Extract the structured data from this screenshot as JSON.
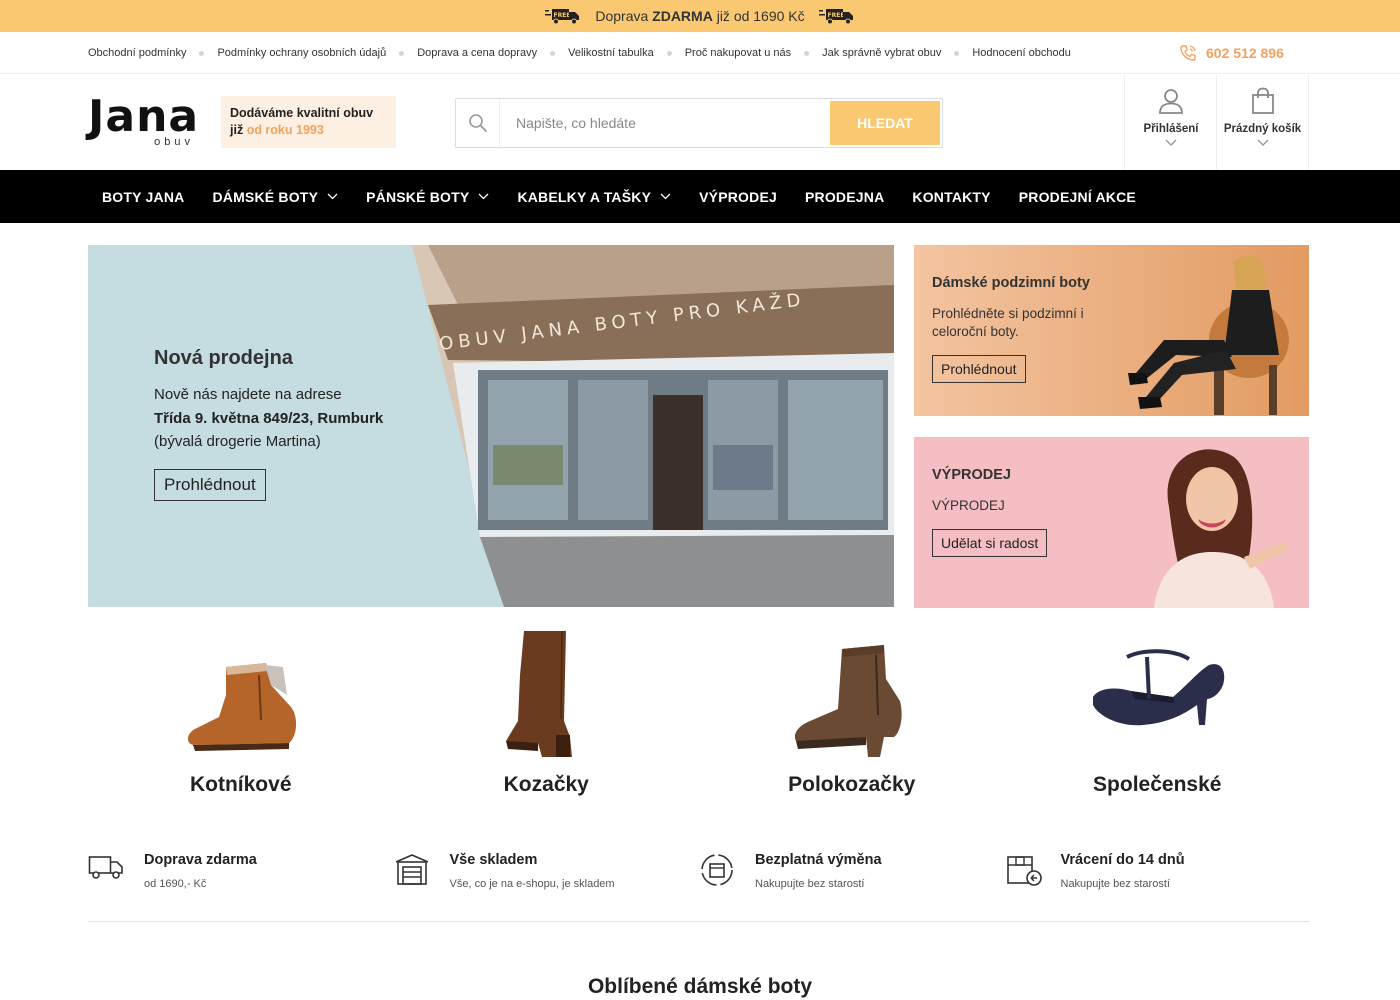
{
  "topbar": {
    "prefix": "Doprava",
    "bold": "ZDARMA",
    "suffix": "již od 1690 Kč",
    "badge": "FREE"
  },
  "links": {
    "items": [
      "Obchodní podmínky",
      "Podmínky ochrany osobních údajů",
      "Doprava a cena dopravy",
      "Velikostní tabulka",
      "Proč nakupovat u nás",
      "Jak správně vybrat obuv",
      "Hodnocení obchodu"
    ],
    "phone": "602 512 896"
  },
  "logo": {
    "word": "Jana",
    "sub": "obuv"
  },
  "tagline": {
    "line1": "Dodáváme kvalitní obuv",
    "prefix": "již",
    "highlight": "od roku 1993"
  },
  "search": {
    "placeholder": "Napište, co hledáte",
    "button": "HLEDAT"
  },
  "account": {
    "login": "Přihlášení",
    "cart": "Prázdný košík"
  },
  "nav": [
    "BOTY JANA",
    "DÁMSKÉ BOTY",
    "PÁNSKÉ BOTY",
    "KABELKY A TAŠKY",
    "VÝPRODEJ",
    "PRODEJNA",
    "KONTAKTY",
    "PRODEJNÍ AKCE"
  ],
  "hero": {
    "title": "Nová prodejna",
    "line1": "Nově nás najdete na adrese",
    "address": "Třída 9. května 849/23, Rumburk",
    "note": "(bývalá drogerie Martina)",
    "button": "Prohlédnout",
    "sign": "OBUV JANA   BOTY PRO KAŽD"
  },
  "promos": [
    {
      "title": "Dámské podzimní boty",
      "text": "Prohlédněte si podzimní i celoroční boty.",
      "button": "Prohlédnout"
    },
    {
      "title": "VÝPRODEJ",
      "text": "VÝPRODEJ",
      "button": "Udělat si radost"
    }
  ],
  "categories": [
    "Kotníkové",
    "Kozačky",
    "Polokozačky",
    "Společenské"
  ],
  "benefits": [
    {
      "title": "Doprava zdarma",
      "sub": "od 1690,- Kč"
    },
    {
      "title": "Vše skladem",
      "sub": "Vše, co je na e-shopu, je skladem"
    },
    {
      "title": "Bezplatná výměna",
      "sub": "Nakupujte bez starostí"
    },
    {
      "title": "Vrácení do 14 dnů",
      "sub": "Nakupujte bez starostí"
    }
  ],
  "section_title": "Oblíbené dámské boty",
  "colors": {
    "accent": "#fbc872",
    "accent_text": "#f3a25e",
    "nav_bg": "#000000",
    "hero_bg": "#c5dde1",
    "promo1_bg": "#e8a36d",
    "promo2_bg": "#f4bec3"
  }
}
